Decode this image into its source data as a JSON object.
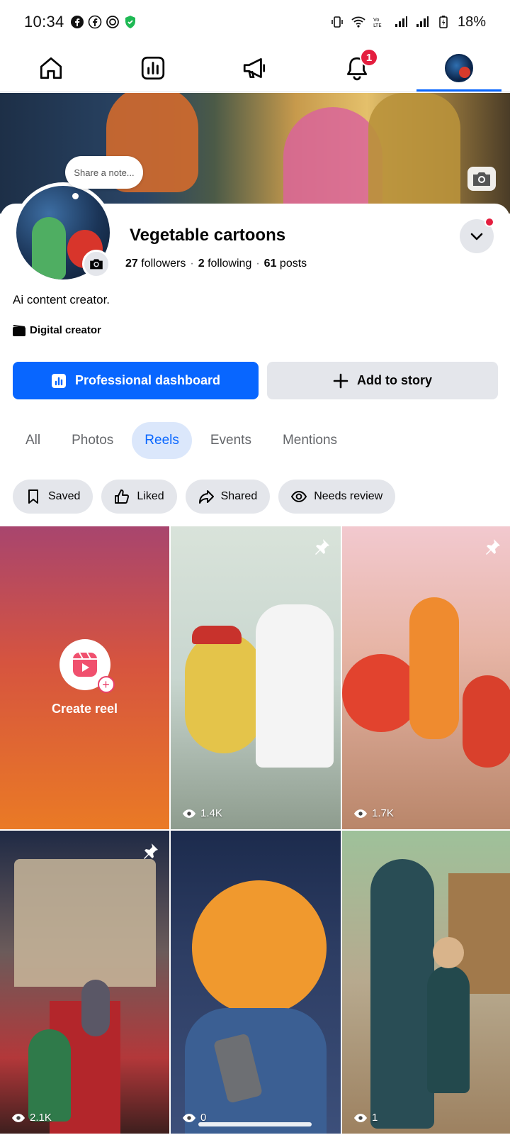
{
  "status_bar": {
    "time": "10:34",
    "battery": "18%",
    "left_icons": [
      "facebook-icon",
      "facebook-icon",
      "ring-app-icon",
      "shield-icon"
    ],
    "right_icons": [
      "vibrate-icon",
      "wifi-icon",
      "volte-icon",
      "signal-icon",
      "signal-icon",
      "battery-charging-icon"
    ]
  },
  "nav": {
    "items": [
      {
        "name": "home",
        "icon": "home-icon"
      },
      {
        "name": "dashboard",
        "icon": "insights-icon"
      },
      {
        "name": "ads",
        "icon": "megaphone-icon"
      },
      {
        "name": "notifications",
        "icon": "bell-icon",
        "badge": "1"
      },
      {
        "name": "profile",
        "icon": "avatar-icon",
        "active": true
      }
    ]
  },
  "profile": {
    "note_placeholder": "Share a note...",
    "name": "Vegetable cartoons",
    "followers_count": "27",
    "followers_label": "followers",
    "following_count": "2",
    "following_label": "following",
    "posts_count": "61",
    "posts_label": "posts",
    "bio": "Ai content creator.",
    "category": "Digital creator"
  },
  "actions": {
    "primary_label": "Professional dashboard",
    "secondary_label": "Add to story"
  },
  "tabs": [
    {
      "label": "All",
      "active": false
    },
    {
      "label": "Photos",
      "active": false
    },
    {
      "label": "Reels",
      "active": true
    },
    {
      "label": "Events",
      "active": false
    },
    {
      "label": "Mentions",
      "active": false
    }
  ],
  "filters": [
    {
      "label": "Saved",
      "icon": "bookmark-icon"
    },
    {
      "label": "Liked",
      "icon": "thumbs-up-icon"
    },
    {
      "label": "Shared",
      "icon": "share-icon"
    },
    {
      "label": "Needs review",
      "icon": "eye-icon"
    }
  ],
  "grid": {
    "create_label": "Create reel",
    "reels": [
      {
        "views": "1.4K",
        "pinned": true
      },
      {
        "views": "1.7K",
        "pinned": true
      },
      {
        "views": "2.1K",
        "pinned": true
      },
      {
        "views": "0",
        "pinned": false
      },
      {
        "views": "1",
        "pinned": false
      }
    ]
  },
  "colors": {
    "accent": "#0866ff",
    "badge": "#e41e3f",
    "chip_bg": "#e4e6eb",
    "active_tab_bg": "#dbe7fb"
  }
}
